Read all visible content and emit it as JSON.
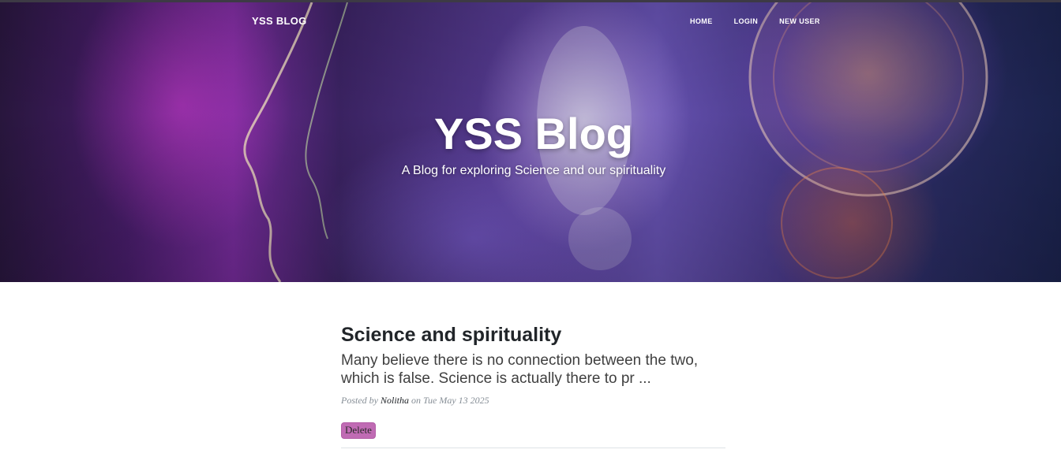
{
  "navbar": {
    "brand": "YSS BLOG",
    "links": [
      "HOME",
      "LOGIN",
      "NEW USER"
    ]
  },
  "header": {
    "title": "YSS Blog",
    "subtitle": "A Blog for exploring Science and our spirituality"
  },
  "posts": [
    {
      "title": "Science and spirituality",
      "excerpt": "Many believe there is no connection between the two, which is false. Science is actually there to pr ...",
      "posted_by_label": "Posted by",
      "author": "Nolitha",
      "on_label": "on",
      "date": "Tue May 13 2025",
      "delete_label": "Delete"
    }
  ],
  "colors": {
    "delete_button": "#c06bb4",
    "hero_tint": "#5a3f9a",
    "heading_text": "#212529"
  }
}
